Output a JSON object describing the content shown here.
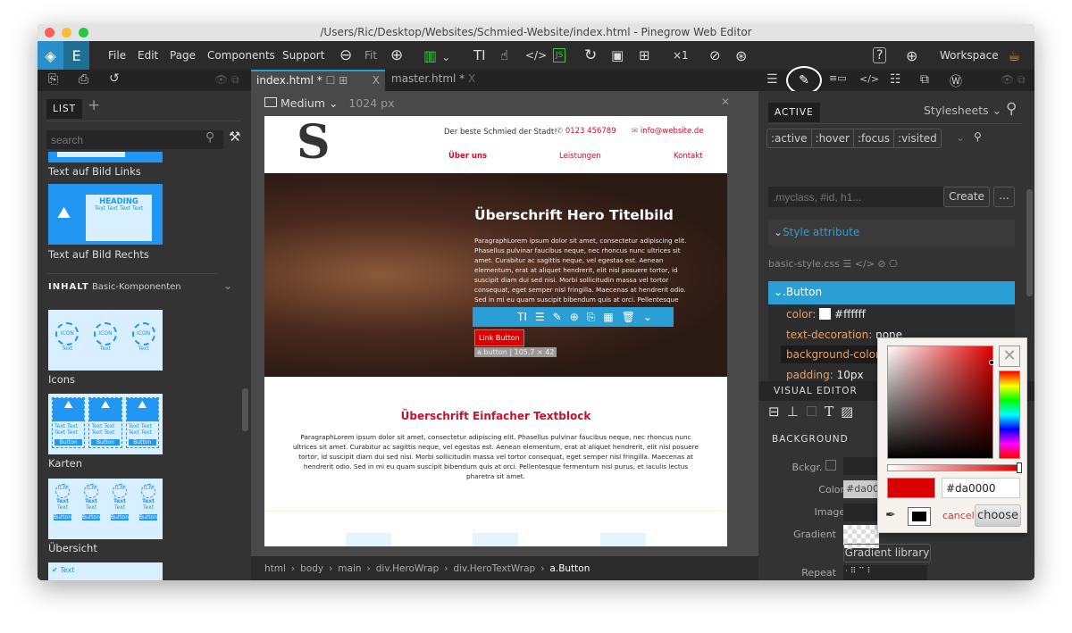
{
  "window": {
    "title": "/Users/Ric/Desktop/Websites/Schmied-Website/index.html - Pinegrow Web Editor"
  },
  "menu": [
    "File",
    "Edit",
    "Page",
    "Components",
    "Support"
  ],
  "toolbar": {
    "logo_letter": "E",
    "fit": "Fit",
    "multiplier": "×1",
    "workspace": "Workspace"
  },
  "tabs": [
    {
      "label": "index.html *"
    },
    {
      "label": "master.html *"
    }
  ],
  "left": {
    "tab": "LIST",
    "search_placeholder": "search",
    "items": [
      "Text auf Bild Links",
      "Text auf Bild Rechts",
      "Icons",
      "Karten",
      "Übersicht"
    ],
    "section_title": "INHALT",
    "section_sub": "Basic-Komponenten",
    "thumb_heading": "HEADING",
    "thumb_text": "Text Text Text Text",
    "icon_label": "ICON",
    "icn_label": "ICN",
    "text": "Text",
    "button": "Button"
  },
  "canvas": {
    "device": "Medium",
    "width": "1024 px",
    "tagline": "Der beste Schmied der Stadt!",
    "phone": "0123 456789",
    "email": "info@website.de",
    "nav": [
      "Über uns",
      "Leistungen",
      "Kontakt"
    ],
    "hero_title": "Überschrift Hero Titelbild",
    "hero_text": "ParagraphLorem ipsum dolor sit amet, consectetur adipiscing elit. Phasellus pulvinar faucibus neque, nec rhoncus nunc ultrices sit amet. Curabitur ac sagittis neque, vel egestas est. Aenean elementum, erat at aliquet hendrerit, elit nisl posuere tortor, id suscipit diam dui sed nisi. Morbi sollicitudin massa vel tortor consequat, eget semper nisl fringilla. Maecenas at hendrerit odio. Sed in mi eu quam suscipit bibendum quis at orci. Pellentesque",
    "link_button": "Link Button",
    "selection_info": "a.button | 105.7 × 42",
    "block_title": "Überschrift Einfacher Textblock",
    "block_text": "ParagraphLorem ipsum dolor sit amet, consectetur adipiscing elit. Phasellus pulvinar faucibus neque, nec rhoncus nunc ultrices sit amet. Curabitur ac sagittis neque, vel egestas est. Aenean elementum, erat at aliquet hendrerit, elit nisl posuere tortor, id suscipit diam dui sed nisi. Morbi sollicitudin massa vel tortor consequat, eget semper nisl fringilla. Maecenas at hendrerit odio. Sed in mi eu quam suscipit bibendum quis at orci. Pellentesque fermentum nisl purus, et iaculis lectus pharetra sit amet."
  },
  "breadcrumb": [
    "html",
    "body",
    "main",
    "div.HeroWrap",
    "div.HeroTextWrap",
    "a.Button"
  ],
  "right": {
    "tab": "ACTIVE",
    "stylesheets": "Stylesheets",
    "states": [
      ":active",
      ":hover",
      ":focus",
      ":visited"
    ],
    "selector_placeholder": ".myclass, #id, h1...",
    "create": "Create",
    "more": "...",
    "style_attr": "Style attribute",
    "css_file": "basic-style.css",
    "rule": ".Button",
    "props": [
      {
        "name": "color",
        "value": "#ffffff",
        "swatch": "#ffffff"
      },
      {
        "name": "text-decoration",
        "value": "none"
      },
      {
        "name": "background-color",
        "value": "#da0000",
        "swatch": "#da0000"
      },
      {
        "name": "padding",
        "value": "10px"
      }
    ],
    "visual_editor": "VISUAL EDITOR",
    "background": "BACKGROUND",
    "bckgr": "Bckgr.",
    "color_lbl": "Color",
    "color_val": "#da00",
    "image": "Image",
    "gradient": "Gradient",
    "gradient_library": "Gradient library",
    "repeat": "Repeat"
  },
  "picker": {
    "value": "#da0000",
    "cancel": "cancel",
    "choose": "choose",
    "color": "#da0000"
  },
  "colors": {
    "accent": "#2a9fd6",
    "brand_red": "#c8102e"
  }
}
